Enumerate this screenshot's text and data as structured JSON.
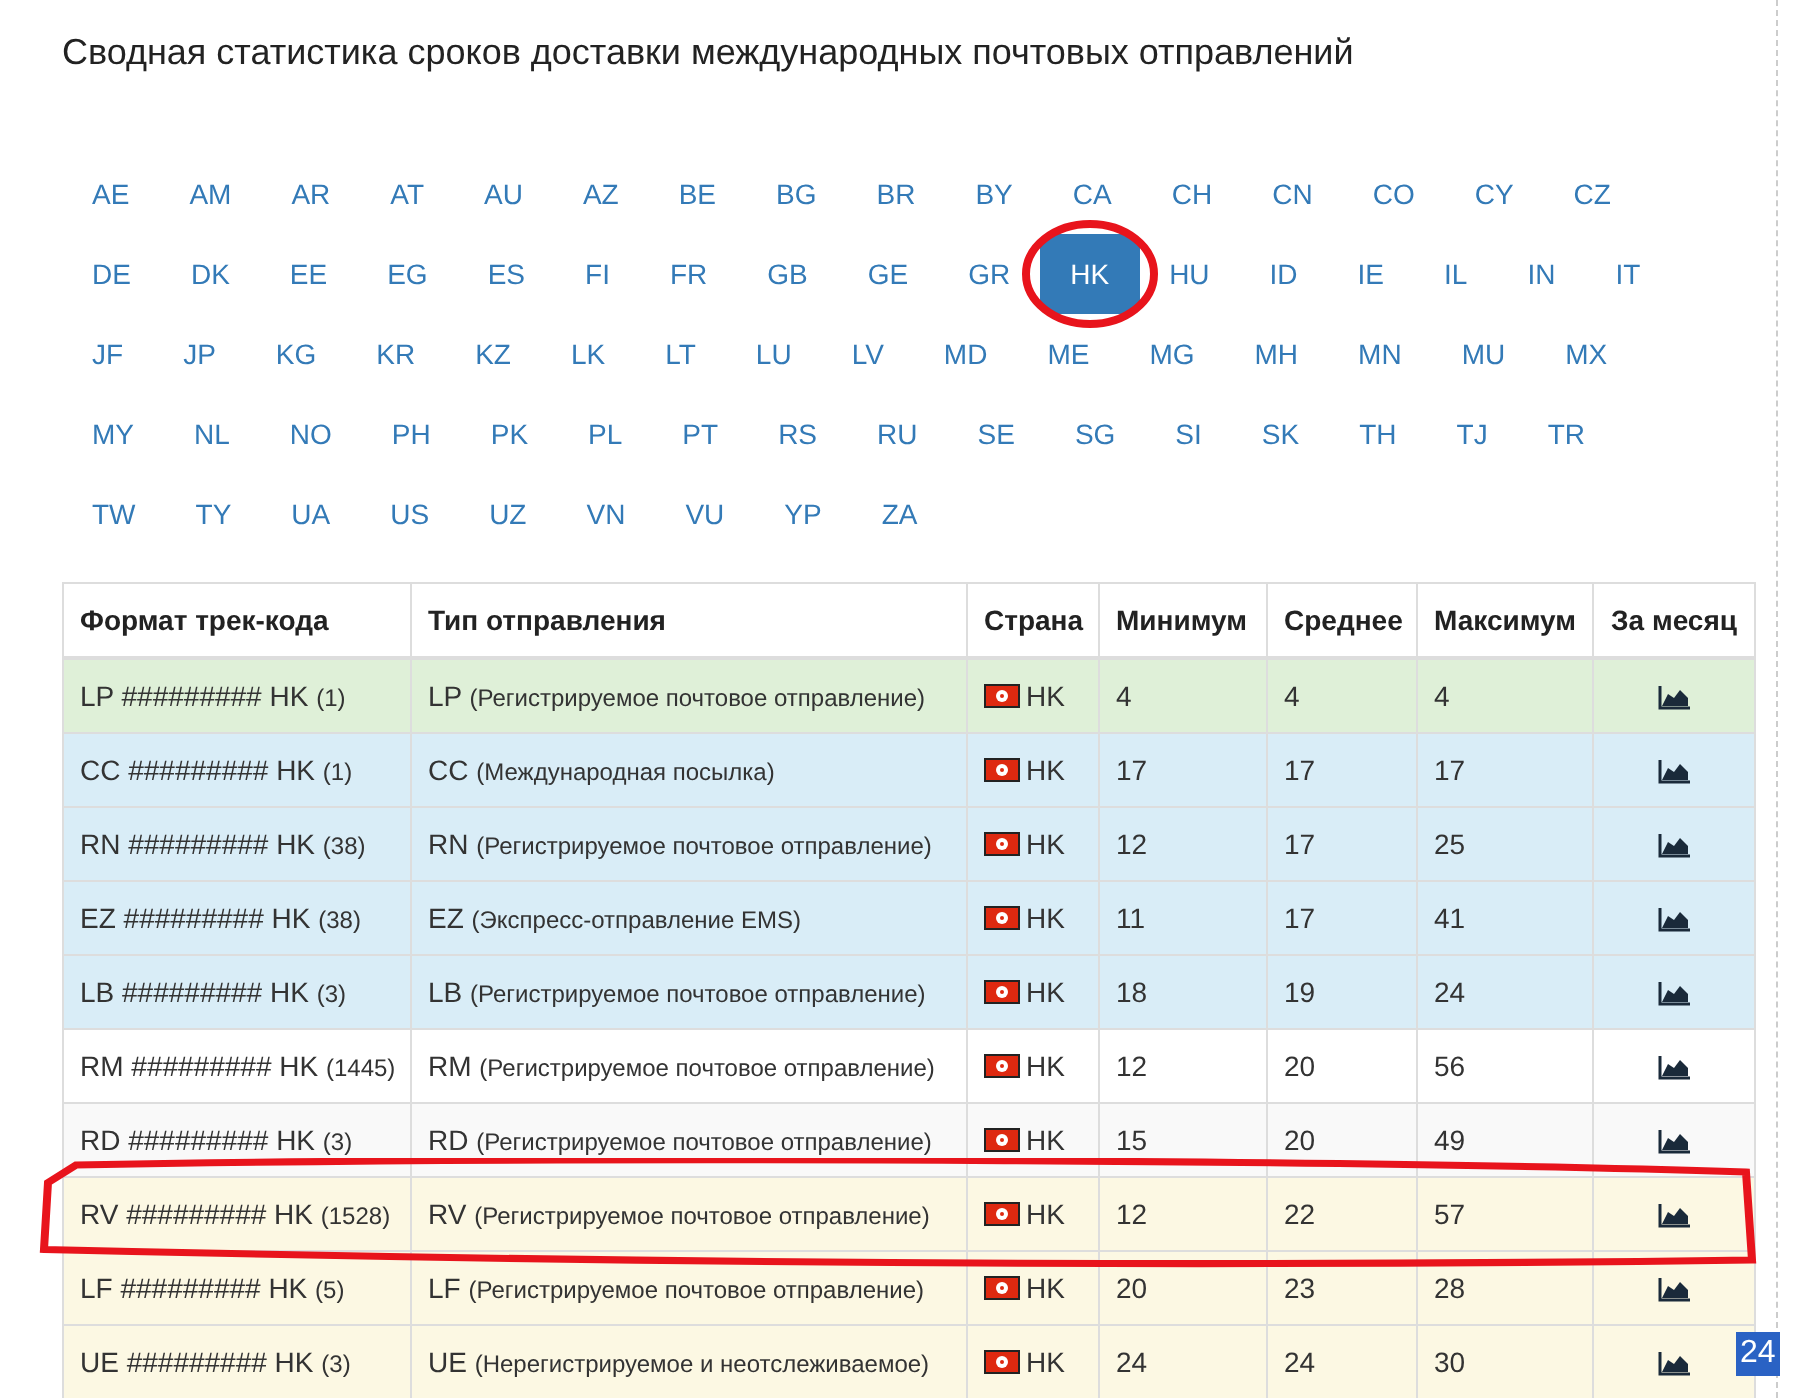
{
  "title": "Сводная статистика сроков доставки международных почтовых отправлений",
  "countries": [
    {
      "code": "AE",
      "selected": false
    },
    {
      "code": "AM",
      "selected": false
    },
    {
      "code": "AR",
      "selected": false
    },
    {
      "code": "AT",
      "selected": false
    },
    {
      "code": "AU",
      "selected": false
    },
    {
      "code": "AZ",
      "selected": false
    },
    {
      "code": "BE",
      "selected": false
    },
    {
      "code": "BG",
      "selected": false
    },
    {
      "code": "BR",
      "selected": false
    },
    {
      "code": "BY",
      "selected": false
    },
    {
      "code": "CA",
      "selected": false
    },
    {
      "code": "CH",
      "selected": false
    },
    {
      "code": "CN",
      "selected": false
    },
    {
      "code": "CO",
      "selected": false
    },
    {
      "code": "CY",
      "selected": false
    },
    {
      "code": "CZ",
      "selected": false
    },
    {
      "code": "DE",
      "selected": false
    },
    {
      "code": "DK",
      "selected": false
    },
    {
      "code": "EE",
      "selected": false
    },
    {
      "code": "EG",
      "selected": false
    },
    {
      "code": "ES",
      "selected": false
    },
    {
      "code": "FI",
      "selected": false
    },
    {
      "code": "FR",
      "selected": false
    },
    {
      "code": "GB",
      "selected": false
    },
    {
      "code": "GE",
      "selected": false
    },
    {
      "code": "GR",
      "selected": false
    },
    {
      "code": "HK",
      "selected": true,
      "circled": true
    },
    {
      "code": "HU",
      "selected": false
    },
    {
      "code": "ID",
      "selected": false
    },
    {
      "code": "IE",
      "selected": false
    },
    {
      "code": "IL",
      "selected": false
    },
    {
      "code": "IN",
      "selected": false
    },
    {
      "code": "IT",
      "selected": false
    },
    {
      "code": "JF",
      "selected": false
    },
    {
      "code": "JP",
      "selected": false
    },
    {
      "code": "KG",
      "selected": false
    },
    {
      "code": "KR",
      "selected": false
    },
    {
      "code": "KZ",
      "selected": false
    },
    {
      "code": "LK",
      "selected": false
    },
    {
      "code": "LT",
      "selected": false
    },
    {
      "code": "LU",
      "selected": false
    },
    {
      "code": "LV",
      "selected": false
    },
    {
      "code": "MD",
      "selected": false
    },
    {
      "code": "ME",
      "selected": false
    },
    {
      "code": "MG",
      "selected": false
    },
    {
      "code": "MH",
      "selected": false
    },
    {
      "code": "MN",
      "selected": false
    },
    {
      "code": "MU",
      "selected": false
    },
    {
      "code": "MX",
      "selected": false
    },
    {
      "code": "MY",
      "selected": false
    },
    {
      "code": "NL",
      "selected": false
    },
    {
      "code": "NO",
      "selected": false
    },
    {
      "code": "PH",
      "selected": false
    },
    {
      "code": "PK",
      "selected": false
    },
    {
      "code": "PL",
      "selected": false
    },
    {
      "code": "PT",
      "selected": false
    },
    {
      "code": "RS",
      "selected": false
    },
    {
      "code": "RU",
      "selected": false
    },
    {
      "code": "SE",
      "selected": false
    },
    {
      "code": "SG",
      "selected": false
    },
    {
      "code": "SI",
      "selected": false
    },
    {
      "code": "SK",
      "selected": false
    },
    {
      "code": "TH",
      "selected": false
    },
    {
      "code": "TJ",
      "selected": false
    },
    {
      "code": "TR",
      "selected": false
    },
    {
      "code": "TW",
      "selected": false
    },
    {
      "code": "TY",
      "selected": false
    },
    {
      "code": "UA",
      "selected": false
    },
    {
      "code": "US",
      "selected": false
    },
    {
      "code": "UZ",
      "selected": false
    },
    {
      "code": "VN",
      "selected": false
    },
    {
      "code": "VU",
      "selected": false
    },
    {
      "code": "YP",
      "selected": false
    },
    {
      "code": "ZA",
      "selected": false
    }
  ],
  "table": {
    "columns": [
      "Формат трек-кода",
      "Тип отправления",
      "Страна",
      "Минимум",
      "Среднее",
      "Максимум",
      "За месяц"
    ],
    "rows": [
      {
        "kind": "success",
        "format": "LP ######### HK",
        "count": "(1)",
        "type_code": "LP",
        "type_name": "(Регистрируемое почтовое отправление)",
        "country": "HK",
        "min": "4",
        "avg": "4",
        "max": "4"
      },
      {
        "kind": "info",
        "format": "CC ######### HK",
        "count": "(1)",
        "type_code": "CC",
        "type_name": "(Международная посылка)",
        "country": "HK",
        "min": "17",
        "avg": "17",
        "max": "17"
      },
      {
        "kind": "info",
        "format": "RN ######### HK",
        "count": "(38)",
        "type_code": "RN",
        "type_name": "(Регистрируемое почтовое отправление)",
        "country": "HK",
        "min": "12",
        "avg": "17",
        "max": "25"
      },
      {
        "kind": "info",
        "format": "EZ ######### HK",
        "count": "(38)",
        "type_code": "EZ",
        "type_name": "(Экспресс-отправление EMS)",
        "country": "HK",
        "min": "11",
        "avg": "17",
        "max": "41"
      },
      {
        "kind": "info",
        "format": "LB ######### HK",
        "count": "(3)",
        "type_code": "LB",
        "type_name": "(Регистрируемое почтовое отправление)",
        "country": "HK",
        "min": "18",
        "avg": "19",
        "max": "24"
      },
      {
        "kind": "plain",
        "format": "RM ######### HK",
        "count": "(1445)",
        "type_code": "RM",
        "type_name": "(Регистрируемое почтовое отправление)",
        "country": "HK",
        "min": "12",
        "avg": "20",
        "max": "56"
      },
      {
        "kind": "muted",
        "format": "RD ######### HK",
        "count": "(3)",
        "type_code": "RD",
        "type_name": "(Регистрируемое почтовое отправление)",
        "country": "HK",
        "min": "15",
        "avg": "20",
        "max": "49"
      },
      {
        "kind": "warning",
        "highlighted": true,
        "format": "RV ######### HK",
        "count": "(1528)",
        "type_code": "RV",
        "type_name": "(Регистрируемое почтовое отправление)",
        "country": "HK",
        "min": "12",
        "avg": "22",
        "max": "57"
      },
      {
        "kind": "warning",
        "format": "LF ######### HK",
        "count": "(5)",
        "type_code": "LF",
        "type_name": "(Регистрируемое почтовое отправление)",
        "country": "HK",
        "min": "20",
        "avg": "23",
        "max": "28"
      },
      {
        "kind": "warning",
        "format": "UE ######### HK",
        "count": "(3)",
        "type_code": "UE",
        "type_name": "(Нерегистрируемое и неотслеживаемое)",
        "country": "HK",
        "min": "24",
        "avg": "24",
        "max": "30"
      }
    ]
  },
  "corner_badge": "24"
}
